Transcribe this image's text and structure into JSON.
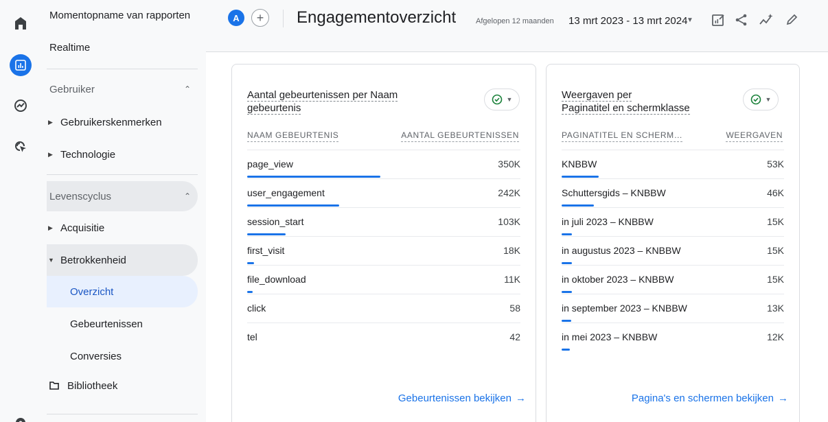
{
  "sidebar": {
    "snapshot": "Momentopname van rapporten",
    "realtime": "Realtime",
    "section_user": "Gebruiker",
    "user_attributes": "Gebruikerskenmerken",
    "technology": "Technologie",
    "section_lifecycle": "Levenscyclus",
    "acquisition": "Acquisitie",
    "engagement": "Betrokkenheid",
    "overview": "Overzicht",
    "events": "Gebeurtenissen",
    "conversions": "Conversies",
    "library": "Bibliotheek"
  },
  "header": {
    "avatar_letter": "A",
    "add_comparison": "+",
    "title": "Engagementoverzicht",
    "date_label": "Afgelopen 12 maanden",
    "date_range": "13 mrt 2023 - 13 mrt 2024"
  },
  "events_card": {
    "title": "Aantal gebeurtenissen per Naam gebeurtenis",
    "col_name": "NAAM GEBEURTENIS",
    "col_value": "AANTAL GEBEURTENISSEN",
    "rows": [
      {
        "name": "page_view",
        "value": "350K",
        "share": 1.0
      },
      {
        "name": "user_engagement",
        "value": "242K",
        "share": 0.69
      },
      {
        "name": "session_start",
        "value": "103K",
        "share": 0.29
      },
      {
        "name": "first_visit",
        "value": "18K",
        "share": 0.05
      },
      {
        "name": "file_download",
        "value": "11K",
        "share": 0.03
      },
      {
        "name": "click",
        "value": "58",
        "share": 0.0
      },
      {
        "name": "tel",
        "value": "42",
        "share": 0.0
      }
    ],
    "link": "Gebeurtenissen bekijken"
  },
  "pages_card": {
    "title_line1": "Weergaven per",
    "title_line2": "Paginatitel en schermklasse",
    "col_name": "PAGINATITEL EN SCHERM…",
    "col_value": "WEERGAVEN",
    "rows": [
      {
        "name": "KNBBW",
        "value": "53K",
        "share": 1.0
      },
      {
        "name": "Schuttersgids – KNBBW",
        "value": "46K",
        "share": 0.87
      },
      {
        "name": "in juli 2023 – KNBBW",
        "value": "15K",
        "share": 0.28
      },
      {
        "name": "in augustus 2023 – KNBBW",
        "value": "15K",
        "share": 0.28
      },
      {
        "name": "in oktober 2023 – KNBBW",
        "value": "15K",
        "share": 0.28
      },
      {
        "name": "in september 2023 – KNBBW",
        "value": "13K",
        "share": 0.25
      },
      {
        "name": "in mei 2023 – KNBBW",
        "value": "12K",
        "share": 0.23
      }
    ],
    "link": "Pagina's en schermen bekijken"
  },
  "colors": {
    "accent": "#1a73e8",
    "check": "#188038"
  }
}
